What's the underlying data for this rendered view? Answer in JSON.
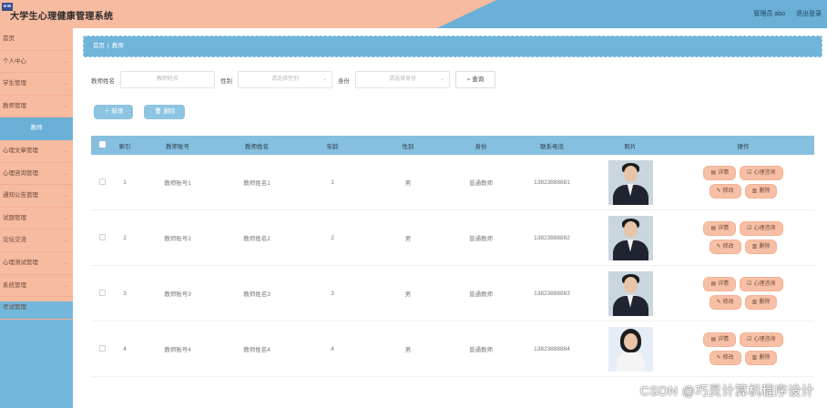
{
  "header": {
    "title": "大学生心理健康管理系统",
    "admin_label": "管理员 abo",
    "logout_label": "退出登录"
  },
  "sidebar": {
    "items": [
      {
        "label": "首页",
        "chevron": false
      },
      {
        "label": "个人中心",
        "chevron": true
      },
      {
        "label": "学生管理",
        "chevron": true
      },
      {
        "label": "教师管理",
        "chevron": true
      },
      {
        "label": "教师",
        "chevron": false,
        "active": true
      },
      {
        "label": "心理文章管理",
        "chevron": true
      },
      {
        "label": "心理咨询管理",
        "chevron": true
      },
      {
        "label": "通知公告管理",
        "chevron": true
      },
      {
        "label": "试题管理",
        "chevron": true
      },
      {
        "label": "论坛交流",
        "chevron": true
      },
      {
        "label": "心理测试管理",
        "chevron": true
      },
      {
        "label": "系统管理",
        "chevron": true
      },
      {
        "label": "考试管理",
        "chevron": true
      }
    ]
  },
  "breadcrumb": {
    "home": "首页",
    "sep": "|",
    "current": "教师"
  },
  "search": {
    "name_label": "教师姓名",
    "name_placeholder": "教师姓名",
    "sex_label": "性别",
    "sex_placeholder": "请选择性别",
    "role_label": "身份",
    "role_placeholder": "请选择身份",
    "query_label": "查询"
  },
  "actions": {
    "add_label": "新增",
    "delete_label": "删除"
  },
  "table": {
    "headers": [
      "索引",
      "教师账号",
      "教师姓名",
      "年龄",
      "性别",
      "身份",
      "联系电话",
      "照片",
      "操作"
    ],
    "rows": [
      {
        "index": "1",
        "account": "教师账号1",
        "name": "教师姓名1",
        "age": "1",
        "sex": "男",
        "role": "普通教师",
        "phone": "13823888881"
      },
      {
        "index": "2",
        "account": "教师账号2",
        "name": "教师姓名2",
        "age": "2",
        "sex": "男",
        "role": "普通教师",
        "phone": "13823888882"
      },
      {
        "index": "3",
        "account": "教师账号3",
        "name": "教师姓名3",
        "age": "3",
        "sex": "男",
        "role": "普通教师",
        "phone": "13823888883"
      },
      {
        "index": "4",
        "account": "教师账号4",
        "name": "教师姓名4",
        "age": "4",
        "sex": "男",
        "role": "普通教师",
        "phone": "13823888884"
      }
    ],
    "ops": {
      "detail": "详情",
      "consult": "心理咨询",
      "edit": "修改",
      "delete": "删除"
    }
  },
  "watermark": "CSDN @巧灵计算机程序设计",
  "colors": {
    "peach": "#f7bba0",
    "blue": "#6ab0d6"
  }
}
